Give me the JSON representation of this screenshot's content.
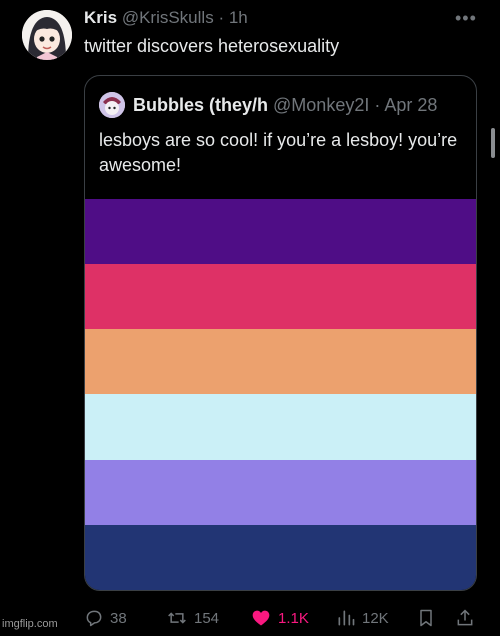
{
  "tweet": {
    "author_name": "Kris",
    "author_handle": "@KrisSkulls",
    "separator": "·",
    "time": "1h",
    "text": "twitter discovers heterosexuality"
  },
  "quoted": {
    "author_name": "Bubbles (they/h",
    "author_handle": "@Monkey2I",
    "separator": "·",
    "date": "Apr 28",
    "text": "lesboys are so cool! if you’re a lesboy! you’re awesome!",
    "flag_colors": [
      "#4f0d86",
      "#de3166",
      "#eca16e",
      "#cbf0f7",
      "#9280e6",
      "#223574"
    ]
  },
  "actions": {
    "replies": "38",
    "retweets": "154",
    "likes": "1.1K",
    "views": "12K"
  },
  "colors": {
    "background": "#000000",
    "like_active": "#f91880",
    "muted": "#71767b"
  },
  "watermark": "imgflip.com"
}
